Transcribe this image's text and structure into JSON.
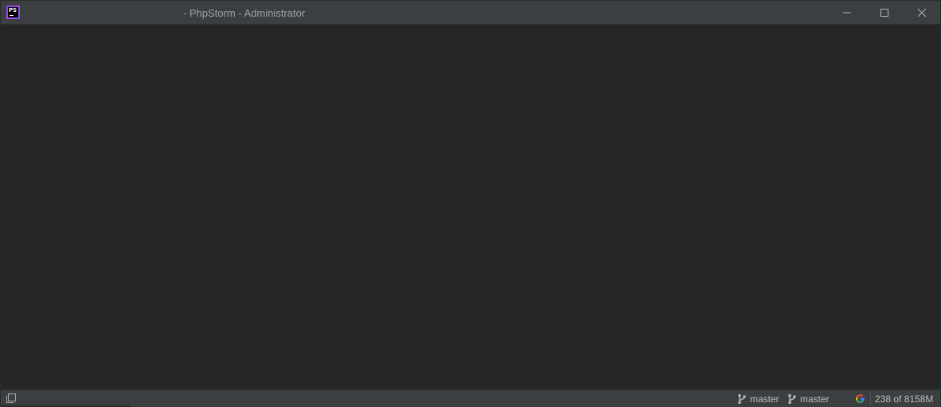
{
  "titlebar": {
    "app_logo_text": "PS",
    "title": "- PhpStorm - Administrator",
    "icons": {
      "app": "phpstorm-logo-icon",
      "minimize": "minimize-icon",
      "maximize": "maximize-icon",
      "close": "close-icon"
    }
  },
  "statusbar": {
    "branches": [
      {
        "label": "master",
        "icon": "git-branch-icon"
      },
      {
        "label": "master",
        "icon": "git-branch-icon"
      }
    ],
    "memory": "238 of 8158M",
    "icons": {
      "toggle": "toggle-tool-windows-icon",
      "google": "google-icon"
    }
  },
  "colors": {
    "titlebar_bg": "#3c3f41",
    "editor_bg": "#262626",
    "text": "#bbbbbb",
    "logo_gradient": [
      "#7b3ff2",
      "#b345f1",
      "#765af8"
    ]
  }
}
